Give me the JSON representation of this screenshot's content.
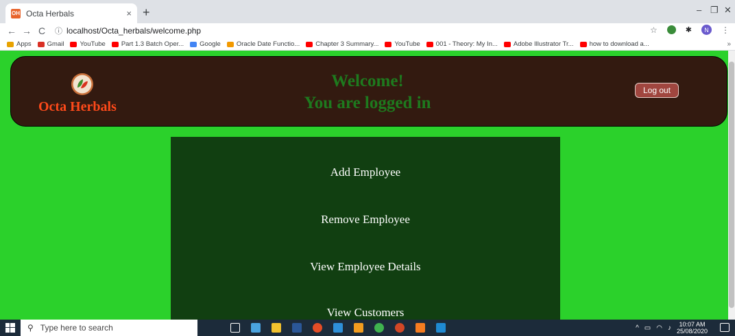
{
  "browser": {
    "tab_title": "Octa Herbals",
    "tab_close": "×",
    "new_tab": "+",
    "url": "localhost/Octa_herbals/welcome.php",
    "win_min": "–",
    "win_restore": "❐",
    "win_close": "✕",
    "back": "←",
    "forward": "→",
    "reload": "C",
    "profile_initial": "N",
    "menu": "⋮",
    "star": "☆"
  },
  "bookmarks": [
    {
      "label": "Apps",
      "color": "#e8a200"
    },
    {
      "label": "Gmail",
      "color": "#d93025"
    },
    {
      "label": "YouTube",
      "color": "#ff0000"
    },
    {
      "label": "Part 1.3 Batch Oper...",
      "color": "#ff0000"
    },
    {
      "label": "Google",
      "color": "#4285f4"
    },
    {
      "label": "Oracle Date Functio...",
      "color": "#f29900"
    },
    {
      "label": "Chapter 3 Summary...",
      "color": "#ff0000"
    },
    {
      "label": "YouTube",
      "color": "#ff0000"
    },
    {
      "label": "001 - Theory: My In...",
      "color": "#ff0000"
    },
    {
      "label": "Adobe Illustrator Tr...",
      "color": "#ff0000"
    },
    {
      "label": "how to download a...",
      "color": "#ff0000"
    }
  ],
  "bookmarks_more": "»",
  "header": {
    "brand": "Octa Herbals",
    "welcome_line1": "Welcome!",
    "welcome_line2": "You are logged in",
    "logout_label": "Log out"
  },
  "menu": {
    "items": [
      "Add Employee",
      "Remove Employee",
      "View Employee Details",
      "View Customers"
    ]
  },
  "taskbar": {
    "search_placeholder": "Type here to search",
    "time": "10:07 AM",
    "date": "25/08/2020",
    "tray_arrow": "^"
  }
}
